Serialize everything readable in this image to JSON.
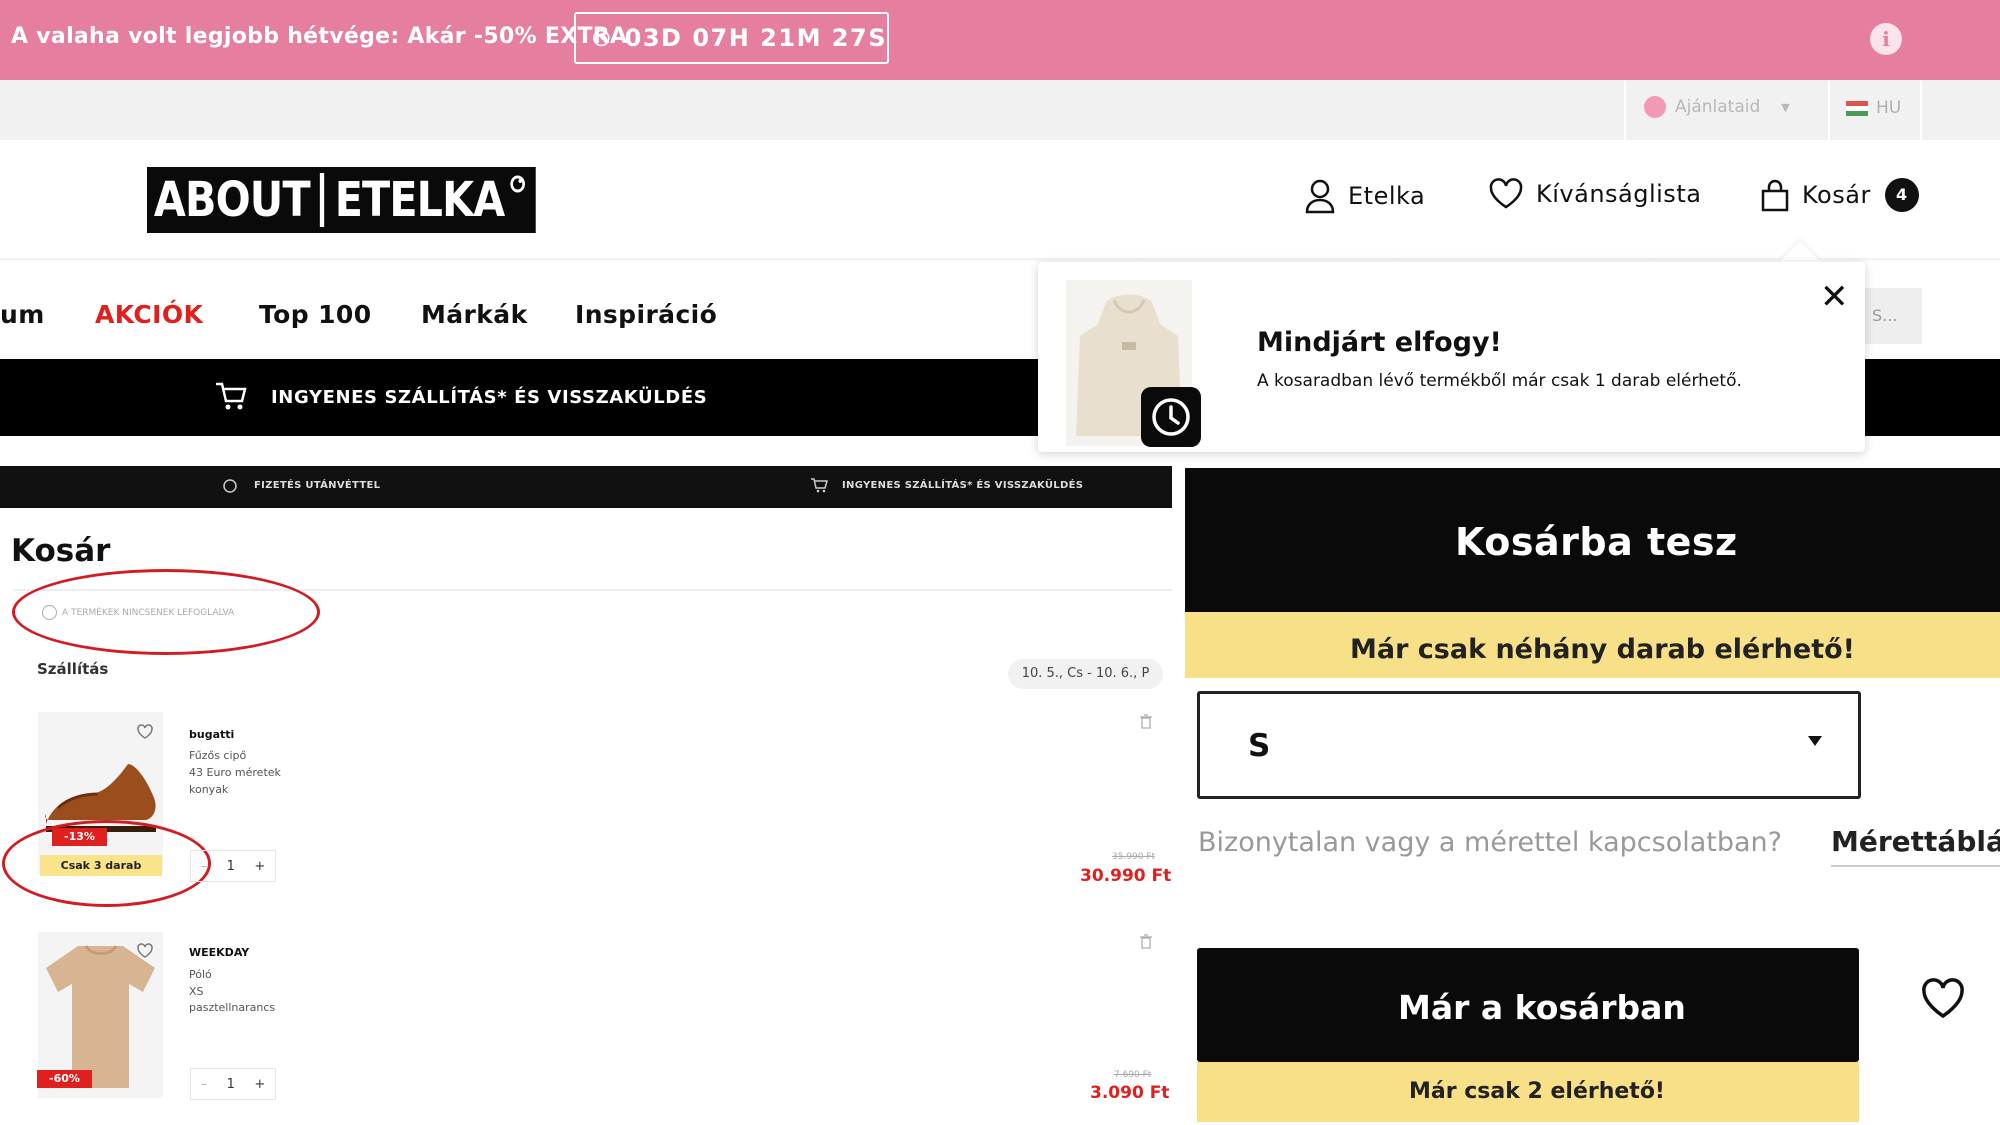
{
  "promo": {
    "text": "A valaha volt legjobb hétvége: Akár -50% EXTRA",
    "countdown": "03D 07H 21M 27S"
  },
  "utility": {
    "offer_label": "Ajánlataid",
    "language": "HU"
  },
  "header": {
    "logo_left": "ABOUT",
    "logo_right": "ETELKA",
    "account_label": "Etelka",
    "wishlist_label": "Kívánságlista",
    "cart_label": "Kosár",
    "cart_count": "4"
  },
  "nav": {
    "partial_item": "um",
    "sale": "AKCIÓK",
    "top100": "Top 100",
    "brands": "Márkák",
    "inspiration": "Inspiráció",
    "search_partial": "S..."
  },
  "banner": {
    "text": "INGYENES SZÁLLÍTÁS* ÉS VISSZAKÜLDÉS"
  },
  "popup": {
    "title": "Mindjárt elfogy!",
    "message": "A kosaradban lévő termékből már csak 1 darab elérhető."
  },
  "cart_page": {
    "strip_left": "FIZETÉS UTÁNVÉTTEL",
    "strip_right": "INGYENES SZÁLLÍTÁS* ÉS VISSZAKÜLDÉS",
    "title": "Kosár",
    "notice": "A TERMÉKEK NINCSENEK LEFOGLALVA",
    "shipping_label": "Szállítás",
    "delivery_window": "10. 5., Cs - 10. 6., P",
    "items": [
      {
        "brand": "bugatti",
        "type": "Fűzős cipő",
        "size": "43 Euro méretek",
        "color": "konyak",
        "discount": "-13%",
        "stock_badge": "Csak 3 darab",
        "qty": "1",
        "old_price": "35.990 Ft",
        "price": "30.990 Ft"
      },
      {
        "brand": "WEEKDAY",
        "type": "Póló",
        "size": "XS",
        "color": "pasztellnarancs",
        "discount": "-60%",
        "qty": "1",
        "old_price": "7.690 Ft",
        "price": "3.090 Ft"
      }
    ]
  },
  "product_panel": {
    "add_to_cart": "Kosárba tesz",
    "low_stock": "Már csak néhány darab elérhető!",
    "size_value": "S",
    "size_question": "Bizonytalan vagy a mérettel kapcsolatban?",
    "size_chart_link": "Mérettábláz",
    "in_cart": "Már a kosárban",
    "remaining": "Már csak 2 elérhető!"
  },
  "colors": {
    "promo": "#e67e9f",
    "sale_red": "#e0201e",
    "stock_yellow": "#f8e088",
    "annotation_red": "#d21c24"
  },
  "icons": [
    "clock-icon",
    "info-icon",
    "user-icon",
    "heart-icon",
    "bag-icon",
    "cart-icon",
    "close-icon",
    "trash-icon",
    "chevron-down-icon"
  ]
}
